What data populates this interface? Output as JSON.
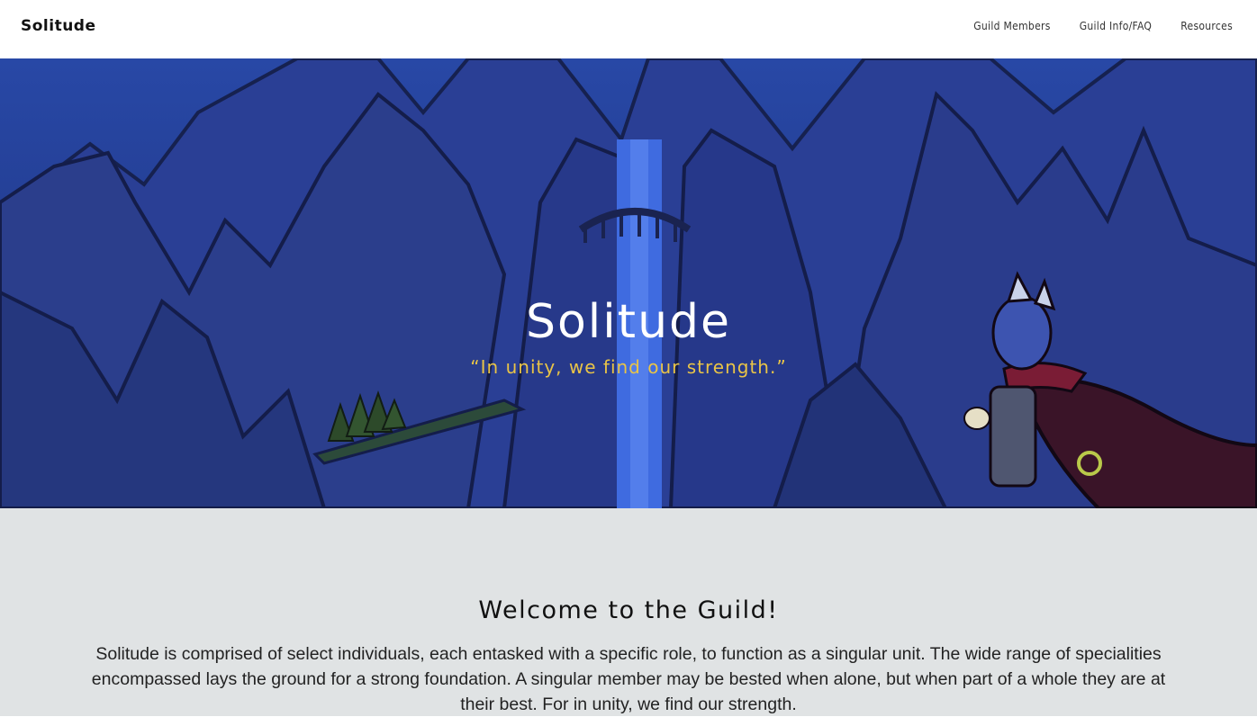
{
  "header": {
    "brand": "Solitude",
    "nav": [
      {
        "label": "Guild Members"
      },
      {
        "label": "Guild Info/FAQ"
      },
      {
        "label": "Resources"
      }
    ]
  },
  "hero": {
    "title": "Solitude",
    "motto": "“In unity, we find our strength.”"
  },
  "welcome": {
    "heading": "Welcome to the Guild!",
    "body": "Solitude is comprised of select individuals, each entasked with a specific role, to function as a singular unit. The wide range of specialities encompassed lays the ground for a strong foundation. A singular member may be bested when alone, but when part of a whole they are at their best. For in unity, we find our strength."
  },
  "colors": {
    "hero_sky": "#22398f",
    "motto": "#e9c447",
    "welcome_bg": "#e0e3e4"
  }
}
